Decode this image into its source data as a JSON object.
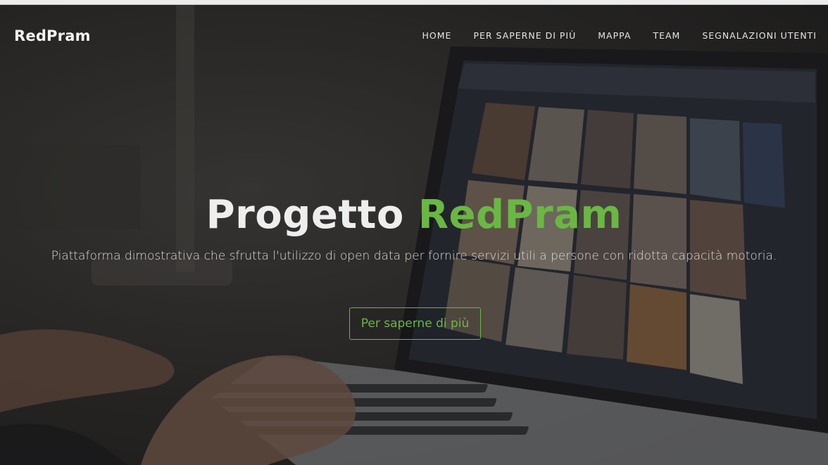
{
  "brand": {
    "name": "RedPram"
  },
  "nav": {
    "items": [
      {
        "label": "HOME"
      },
      {
        "label": "PER SAPERNE DI PIÙ"
      },
      {
        "label": "MAPPA"
      },
      {
        "label": "TEAM"
      },
      {
        "label": "SEGNALAZIONI UTENTI"
      }
    ]
  },
  "hero": {
    "title_prefix": "Progetto",
    "title_accent": "RedPram",
    "subtitle": "Piattaforma dimostrativa che sfrutta l'utilizzo di open data per fornire servizi utili a persone con ridotta capacità motoria.",
    "cta_label": "Per saperne di più"
  },
  "colors": {
    "accent": "#6ab744",
    "text": "#eeeeee"
  },
  "background": {
    "description_icon": "laptop-photo-background"
  }
}
